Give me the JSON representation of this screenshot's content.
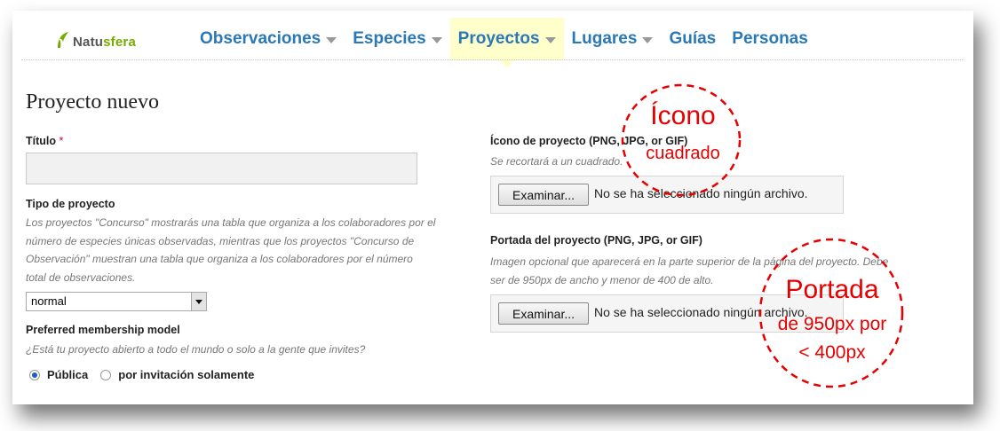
{
  "logo": {
    "text_gray": "Natu",
    "text_green": "sfera"
  },
  "nav": [
    {
      "label": "Observaciones",
      "caret": true,
      "active": false
    },
    {
      "label": "Especies",
      "caret": true,
      "active": false
    },
    {
      "label": "Proyectos",
      "caret": true,
      "active": true
    },
    {
      "label": "Lugares",
      "caret": true,
      "active": false
    },
    {
      "label": "Guías",
      "caret": false,
      "active": false
    },
    {
      "label": "Personas",
      "caret": false,
      "active": false
    }
  ],
  "form": {
    "page_title": "Proyecto nuevo",
    "titulo_label": "Título",
    "required_mark": "*",
    "titulo_value": "",
    "tipo_label": "Tipo de proyecto",
    "tipo_hint_lines": [
      "Los proyectos \"Concurso\" mostrarás una tabla que organiza a los colaboradores por el",
      "número de especies únicas observadas, mientras que los proyectos \"Concurso de",
      "Observación\" muestran una tabla que organiza a los colaboradores por el número",
      "total de observaciones."
    ],
    "tipo_selected": "normal",
    "membership_label": "Preferred membership model",
    "membership_hint": "¿Está tu proyecto abierto a todo el mundo o solo a la gente que invites?",
    "membership_options": [
      {
        "label": "Pública",
        "checked": true
      },
      {
        "label": "por invitación solamente",
        "checked": false
      }
    ],
    "icono_label": "Ícono de proyecto (PNG, JPG, or GIF)",
    "icono_hint": "Se recortará a un cuadrado.",
    "portada_label": "Portada del proyecto (PNG, JPG, or GIF)",
    "portada_hint_lines": [
      "Imagen opcional que aparecerá en la parte superior de la página del proyecto. Debe",
      "ser de 950px de ancho y menor de 400 de alto."
    ],
    "browse_button": "Examinar...",
    "no_file_text": "No se ha seleccionado ningún archivo."
  },
  "annotations": {
    "icono_title": "Ícono",
    "icono_sub": "cuadrado",
    "portada_title": "Portada",
    "portada_line2": "de 950px por",
    "portada_line3": "< 400px",
    "color": "#e60000"
  },
  "colors": {
    "nav_link": "#2a78b5",
    "active_bg": "#ffffcc",
    "logo_green": "#74ac00"
  }
}
